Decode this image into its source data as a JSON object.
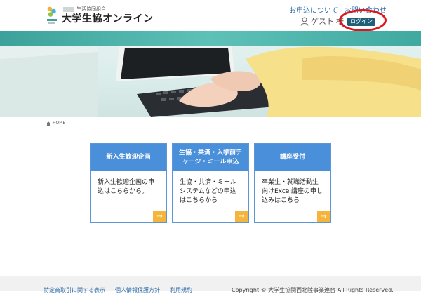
{
  "header": {
    "org_small": "生活協同組合",
    "site_title": "大学生協オンライン",
    "links": [
      "お申込について",
      "お問い合わせ"
    ],
    "guest_label": "ゲスト",
    "guest_suffix": "様",
    "login_label": "ログイン"
  },
  "breadcrumb": {
    "home": "HOME"
  },
  "cards": [
    {
      "title": "新入生歓迎企画",
      "body": "新入生歓迎企画の申込はこちらから。",
      "arrow": "→"
    },
    {
      "title": "生協・共済・入学前チャージ・ミール申込",
      "body": "生協・共済・ミールシステムなどの申込はこちらから",
      "arrow": "→"
    },
    {
      "title": "講座受付",
      "body": "卒業生・就職活動生向けExcel講座の申し込みはこちら",
      "arrow": "→"
    }
  ],
  "footer": {
    "links": [
      "特定商取引に関する表示",
      "個人情報保護方針",
      "利用規約"
    ],
    "copyright": "Copyright © 大学生協関西北陸事業連合 All Rights Reserved."
  },
  "colors": {
    "brand_teal": "#3ba19a",
    "card_blue": "#4a8fd9",
    "arrow_orange": "#f5b53d",
    "login_navy": "#1f5f78",
    "highlight_red": "#e0141b"
  }
}
